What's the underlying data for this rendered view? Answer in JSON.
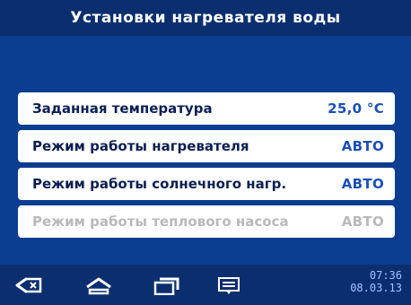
{
  "header": {
    "title": "Установки нагревателя воды"
  },
  "settings": [
    {
      "label": "Заданная температура",
      "value": "25,0 °C",
      "enabled": true
    },
    {
      "label": "Режим работы нагревателя",
      "value": "АВТО",
      "enabled": true
    },
    {
      "label": "Режим работы солнечного нагр.",
      "value": "АВТО",
      "enabled": true
    },
    {
      "label": "Режим работы теплового насоса",
      "value": "АВТО",
      "enabled": false
    }
  ],
  "navbar": {
    "icons": [
      "back-icon",
      "home-icon",
      "recent-apps-icon",
      "menu-icon"
    ],
    "time": "07:36",
    "date": "08.03.13"
  },
  "colors": {
    "background": "#0b3d91",
    "bar": "#0b2f6e",
    "row": "#ffffff",
    "value": "#1a4fb5",
    "disabled_text": "#b9b9b9"
  }
}
